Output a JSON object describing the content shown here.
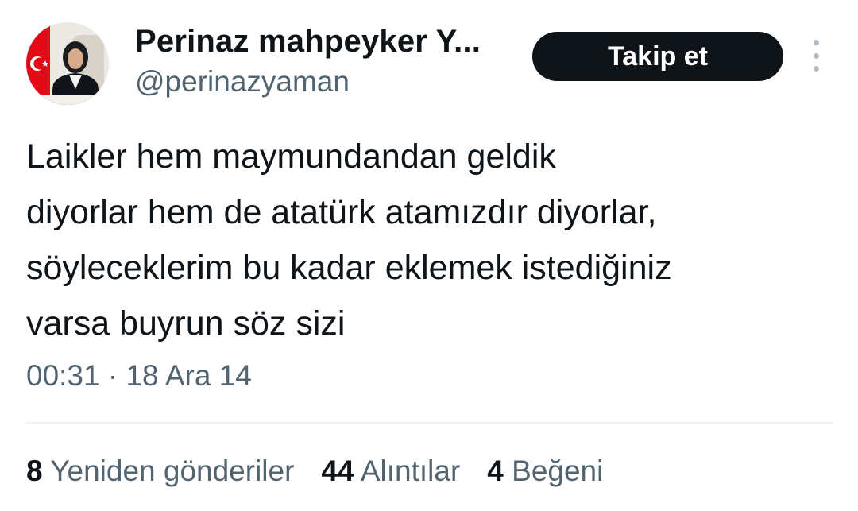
{
  "author": {
    "display_name": "Perinaz mahpeyker Y...",
    "handle": "@perinazyaman"
  },
  "actions": {
    "follow_label": "Takip et",
    "more_icon": "vertical-ellipsis-icon"
  },
  "tweet": {
    "lines": [
      "Laikler hem maymundandan geldik",
      "diyorlar hem de atatürk atamızdır diyorlar,",
      "söyleceklerim bu kadar eklemek istediğiniz",
      "varsa buyrun söz sizi"
    ],
    "timestamp": "00:31 · 18 Ara 14"
  },
  "stats": {
    "reposts_count": "8",
    "reposts_label": "Yeniden gönderiler",
    "quotes_count": "44",
    "quotes_label": "Alıntılar",
    "likes_count": "4",
    "likes_label": "Beğeni"
  },
  "colors": {
    "text_primary": "#0f1419",
    "text_secondary": "#536471",
    "button_bg": "#0f1419",
    "divider": "#eff3f4",
    "flag_red": "#e30a17"
  }
}
